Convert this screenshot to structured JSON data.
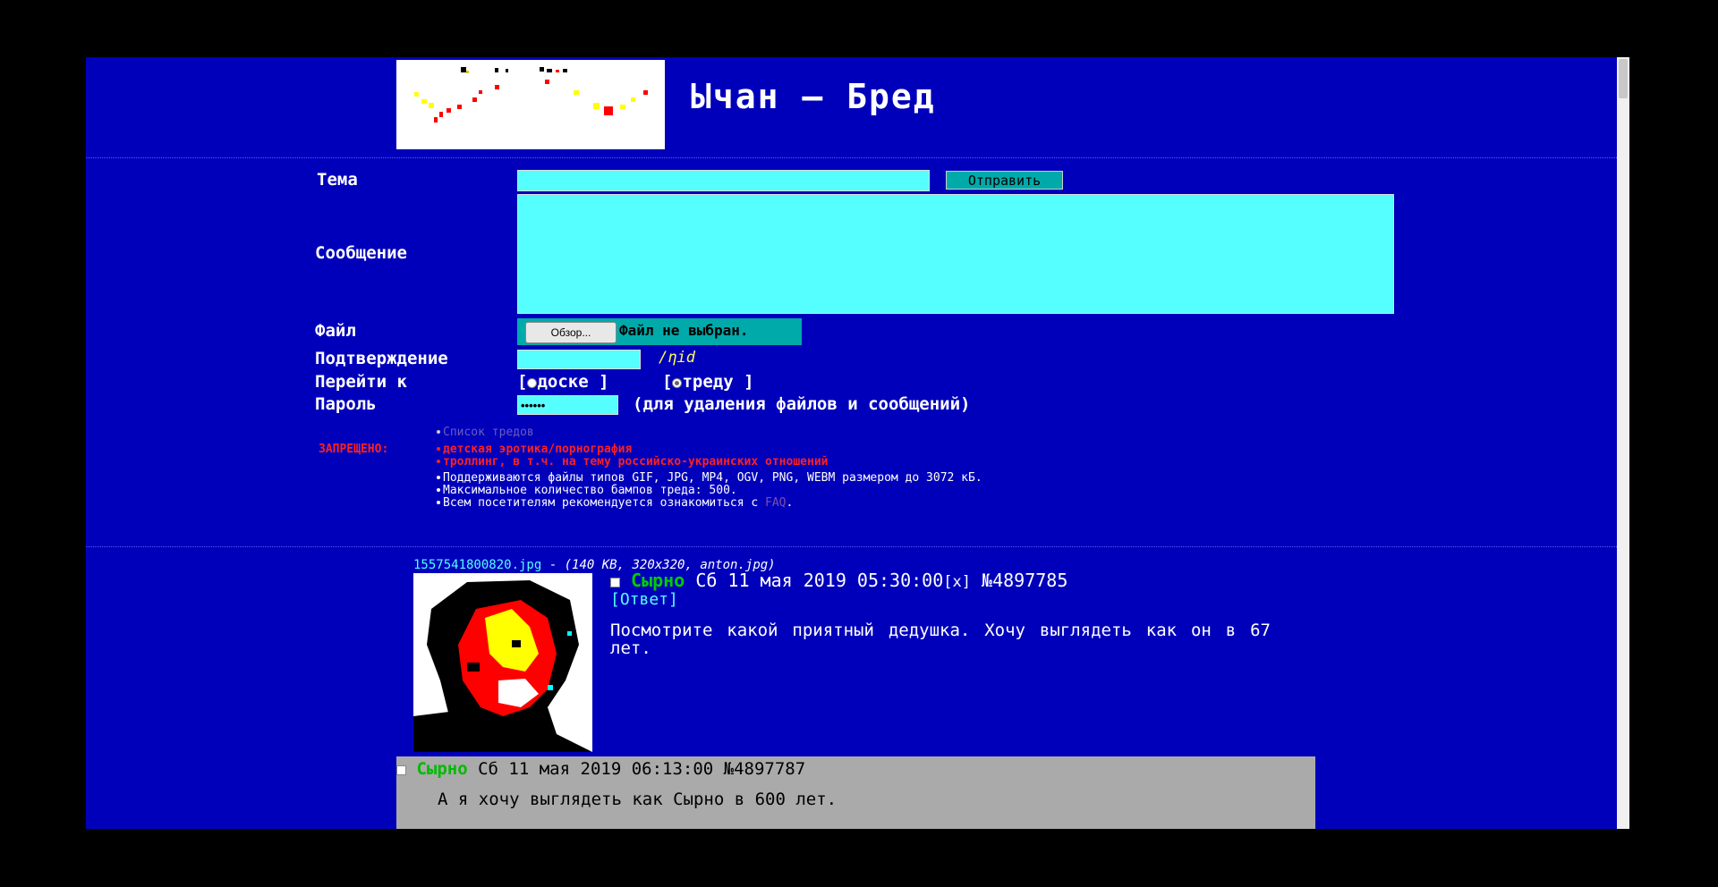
{
  "board": {
    "title": "Ычан — Бред"
  },
  "form": {
    "subject_label": "Тема",
    "submit_label": "Отправить",
    "message_label": "Сообщение",
    "file_label": "Файл",
    "browse_label": "Обзор...",
    "file_status": "Файл не выбран.",
    "captcha_label": "Подтверждение",
    "captcha_text": "/ηid",
    "goto_label": "Перейти к",
    "goto_options": [
      "доске",
      "треду"
    ],
    "goto_selected": "треду",
    "password_label": "Пароль",
    "password_value": "••••••",
    "password_hint": "(для удаления файлов и сообщений)"
  },
  "rules": {
    "thread_list_link": "Список тредов",
    "forbidden_label": "ЗАПРЕЩЕНО:",
    "forbidden_items": [
      "детская эротика/порнография",
      "троллинг, в т.ч. на тему российско-украинских отношений"
    ],
    "info_items": [
      "Поддерживаются файлы типов GIF, JPG, MP4, OGV, PNG, WEBM размером до 3072 кБ.",
      "Максимальное количество бампов треда: 500."
    ],
    "faq_prefix": "Всем посетителям рекомендуется ознакомиться с",
    "faq_link": "FAQ",
    "faq_suffix": "."
  },
  "thread": {
    "file_name": "1557541800820.jpg",
    "file_sep": "-",
    "file_info": "(140 KB, 320x320, anton.jpg)",
    "op": {
      "name": "Сырно",
      "date": "Сб 11 мая 2019 05:30:00",
      "delete": "[x]",
      "number": "№4897785",
      "reply_link": "[Ответ]",
      "message": "Посмотрите какой приятный дедушка. Хочу выглядеть как он в 67 лет."
    },
    "reply": {
      "name": "Сырно",
      "date": "Сб 11 мая 2019 06:13:00",
      "number": "№4897787",
      "message": "А я хочу выглядеть как Сырно в 600 лет."
    }
  },
  "colors": {
    "page_bg": "#0000bb",
    "field_bg": "#55ffff",
    "name": "#00cc00",
    "forbidden": "#ff2020",
    "file_link": "#55ffff",
    "muted_link": "#7b4fa8",
    "reply_bg": "#aaaaaa"
  }
}
